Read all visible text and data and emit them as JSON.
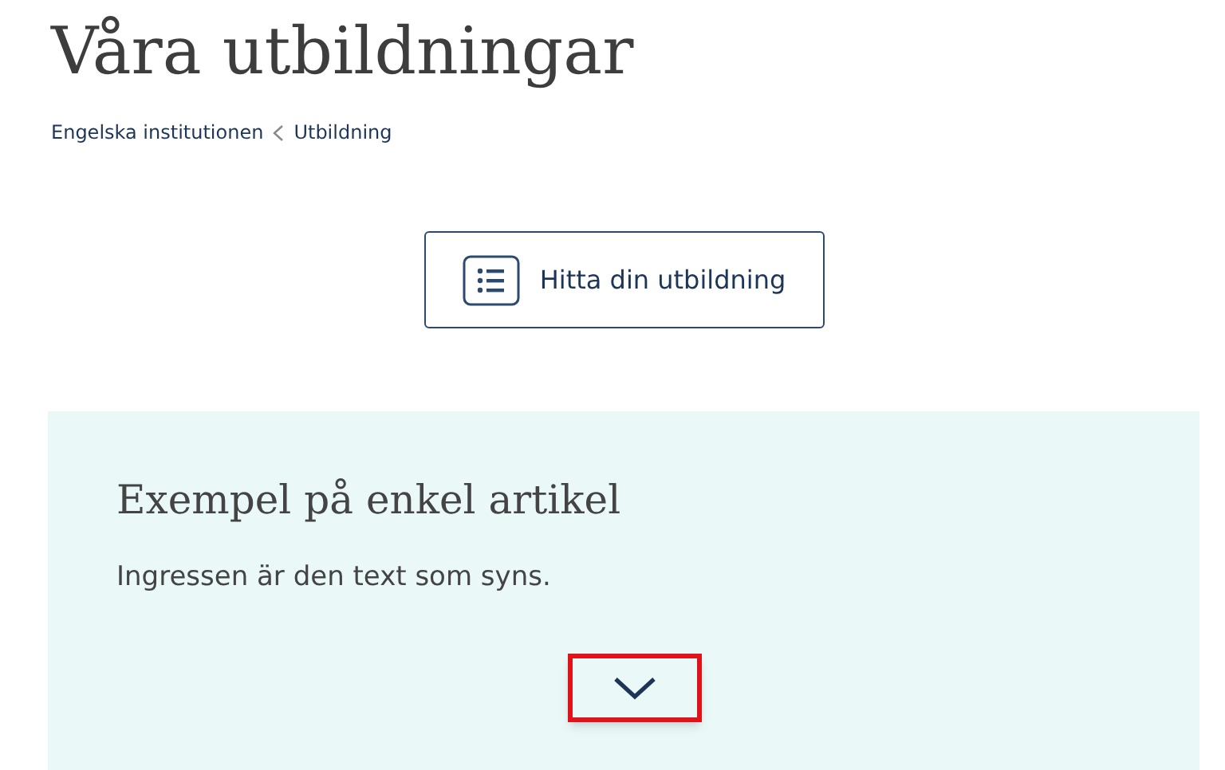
{
  "title": "Våra utbildningar",
  "breadcrumb": [
    "Engelska institutionen",
    "Utbildning"
  ],
  "find_button": {
    "label": "Hitta din utbildning"
  },
  "article": {
    "title": "Exempel på enkel artikel",
    "lead": "Ingressen är den text som syns.",
    "expand_button": {
      "expanded": false,
      "highlighted": true
    }
  }
}
